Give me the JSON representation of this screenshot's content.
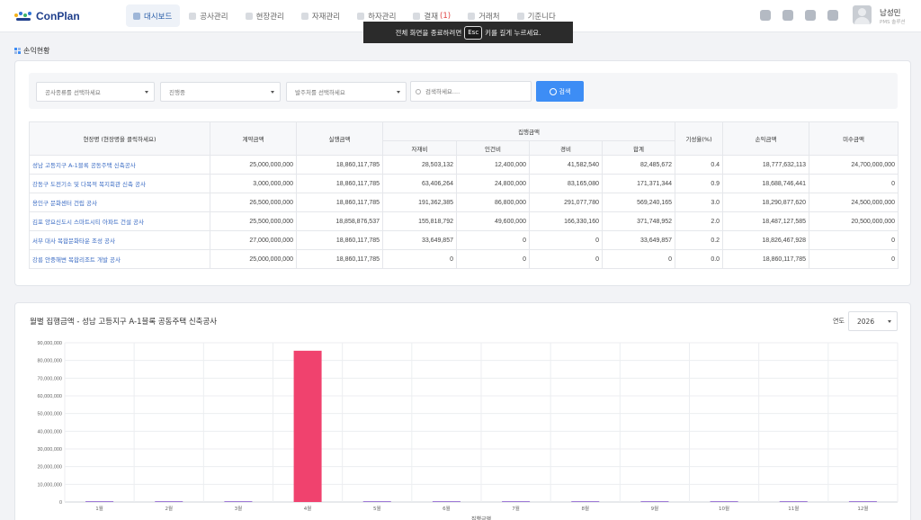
{
  "app": {
    "name": "ConPlan"
  },
  "nav": {
    "items": [
      {
        "label": "대시보드",
        "icon": "dashboard-icon",
        "active": true
      },
      {
        "label": "공사관리",
        "icon": "construction-icon"
      },
      {
        "label": "현장관리",
        "icon": "site-icon"
      },
      {
        "label": "자재관리",
        "icon": "material-icon"
      },
      {
        "label": "하자관리",
        "icon": "defect-icon"
      },
      {
        "label": "결재",
        "icon": "approval-icon",
        "badge": "(1)"
      },
      {
        "label": "거래처",
        "icon": "client-icon"
      },
      {
        "label": "기준니다",
        "icon": "settings-icon"
      }
    ]
  },
  "toast": {
    "before": "전체 화면을 종료하려면",
    "key": "Esc",
    "after": "키를 길게 누르세요."
  },
  "header_icons": [
    "monitor-icon",
    "send-icon",
    "users-icon",
    "card-icon"
  ],
  "user": {
    "name": "남성민",
    "role": "PMS 솔루션"
  },
  "page": {
    "section_title": "손익현황"
  },
  "filters": {
    "type_select": "공사종류를 선택하세요",
    "status_select": "진행중",
    "client_select": "발주처를 선택하세요",
    "search_placeholder": "검색하세요....",
    "search_button": "검색"
  },
  "table": {
    "headers": {
      "site": "현장명 (현장명을 클릭하세요)",
      "contract": "계약금액",
      "budget": "실행금액",
      "execution": "집행금액",
      "progress": "기성율(%)",
      "profit": "손익금액",
      "unpaid": "미수금액"
    },
    "subheaders": [
      "자재비",
      "인건비",
      "경비",
      "합계"
    ],
    "rows": [
      {
        "site": "성남 고등지구 A-1블록 공동주택 신축공사",
        "contract": "25,000,000,000",
        "budget": "18,860,117,785",
        "material": "28,503,132",
        "labor": "12,400,000",
        "expense": "41,582,540",
        "total": "82,485,672",
        "progress": "0.4",
        "profit": "18,777,632,113",
        "unpaid": "24,700,000,000"
      },
      {
        "site": "강동구 도전기소 및 다목적 복지회관 신축 공사",
        "contract": "3,000,000,000",
        "budget": "18,860,117,785",
        "material": "63,406,264",
        "labor": "24,800,000",
        "expense": "83,165,080",
        "total": "171,371,344",
        "progress": "0.9",
        "profit": "18,688,746,441",
        "unpaid": "0"
      },
      {
        "site": "용인구 문화센터 건립 공사",
        "contract": "26,500,000,000",
        "budget": "18,860,117,785",
        "material": "191,362,385",
        "labor": "86,800,000",
        "expense": "291,077,780",
        "total": "569,240,165",
        "progress": "3.0",
        "profit": "18,290,877,620",
        "unpaid": "24,500,000,000"
      },
      {
        "site": "김포 양요신도시 스마트시티 아파트 건설 공사",
        "contract": "25,500,000,000",
        "budget": "18,858,876,537",
        "material": "155,818,792",
        "labor": "49,600,000",
        "expense": "166,330,160",
        "total": "371,748,952",
        "progress": "2.0",
        "profit": "18,487,127,585",
        "unpaid": "20,500,000,000"
      },
      {
        "site": "서부 대사 복합문화타운 조성 공사",
        "contract": "27,000,000,000",
        "budget": "18,860,117,785",
        "material": "33,649,857",
        "labor": "0",
        "expense": "0",
        "total": "33,649,857",
        "progress": "0.2",
        "profit": "18,826,467,928",
        "unpaid": "0"
      },
      {
        "site": "강릉 안중해변 복합리조트 개발 공사",
        "contract": "25,000,000,000",
        "budget": "18,860,117,785",
        "material": "0",
        "labor": "0",
        "expense": "0",
        "total": "0",
        "progress": "0.0",
        "profit": "18,860,117,785",
        "unpaid": "0"
      }
    ]
  },
  "chart_section": {
    "title": "월별 집행금액 - 성남 고등지구 A-1블록 공동주택 신축공사",
    "year_label": "연도",
    "year_value": "2026"
  },
  "colors": {
    "accent": "#3d8df5",
    "bar": "#f0426e",
    "link": "#3b6cc4",
    "logo": "#1f3f8c"
  },
  "chart_data": {
    "type": "bar",
    "categories": [
      "1월",
      "2월",
      "3월",
      "4월",
      "5월",
      "6월",
      "7월",
      "8월",
      "9월",
      "10월",
      "11월",
      "12월"
    ],
    "values": [
      0,
      0,
      0,
      85500000,
      0,
      0,
      0,
      0,
      0,
      0,
      0,
      0
    ],
    "yticks": [
      "90,000,000",
      "80,000,000",
      "70,000,000",
      "60,000,000",
      "50,000,000",
      "40,000,000",
      "30,000,000",
      "20,000,000",
      "10,000,000",
      "0"
    ],
    "ylim": [
      0,
      90000000
    ],
    "xlabel": "집행금액",
    "grid": true
  }
}
